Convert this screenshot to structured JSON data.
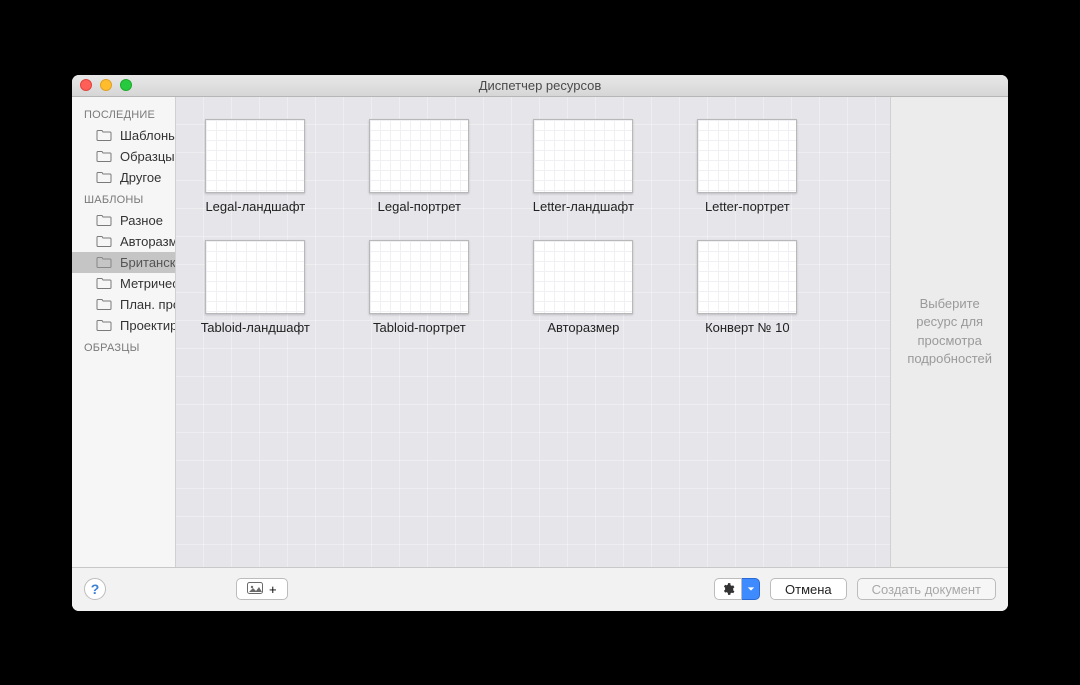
{
  "window": {
    "title": "Диспетчер ресурсов"
  },
  "sidebar": {
    "groups": [
      {
        "header": "ПОСЛЕДНИЕ",
        "items": [
          {
            "label": "Шаблоны",
            "selected": false
          },
          {
            "label": "Образцы",
            "selected": false
          },
          {
            "label": "Другое",
            "selected": false
          }
        ]
      },
      {
        "header": "ШАБЛОНЫ",
        "items": [
          {
            "label": "Разное",
            "selected": false
          },
          {
            "label": "Авторазмещение",
            "selected": false
          },
          {
            "label": "Британские ед.",
            "selected": true
          },
          {
            "label": "Метрические ед.",
            "selected": false
          },
          {
            "label": "План. пространства",
            "selected": false
          },
          {
            "label": "Проектирование ПО",
            "selected": false
          }
        ]
      },
      {
        "header": "ОБРАЗЦЫ",
        "items": []
      }
    ]
  },
  "templates": [
    {
      "label": "Legal-ландшафт"
    },
    {
      "label": "Legal-портрет"
    },
    {
      "label": "Letter-ландшафт"
    },
    {
      "label": "Letter-портрет"
    },
    {
      "label": "Tabloid-ландшафт"
    },
    {
      "label": "Tabloid-портрет"
    },
    {
      "label": "Авторазмер"
    },
    {
      "label": "Конверт № 10"
    }
  ],
  "info": {
    "placeholder": "Выберите ресурс для просмотра подробностей"
  },
  "footer": {
    "help_label": "?",
    "add_canvas_label": "+",
    "cancel_label": "Отмена",
    "create_label": "Создать документ"
  }
}
